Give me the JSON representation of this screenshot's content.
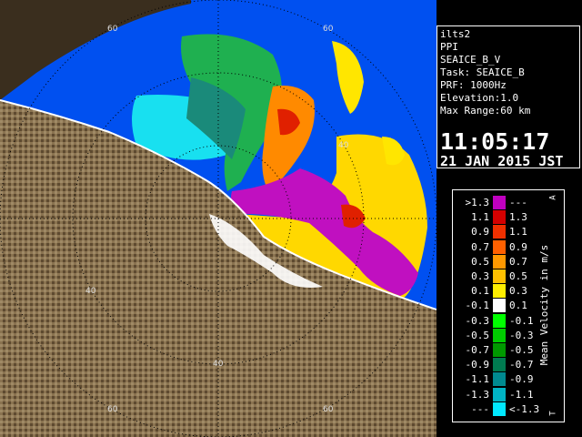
{
  "info": {
    "site": "ilts2",
    "mode": "PPI",
    "product": "SEAICE_B_V",
    "task": "Task: SEAICE_B",
    "prf": "PRF: 1000Hz",
    "elevation": "Elevation:1.0",
    "max_range": "Max Range:60 km",
    "time": "11:05:17",
    "date": "21 JAN 2015 JST"
  },
  "legend": {
    "unit": "Mean Velocity in m/s",
    "corner_top": "A",
    "corner_bottom": "T",
    "rows": [
      {
        "left": ">1.3",
        "right": "---",
        "color": "#c000c0"
      },
      {
        "left": "1.1",
        "right": "1.3",
        "color": "#d40000"
      },
      {
        "left": "0.9",
        "right": "1.1",
        "color": "#f03000"
      },
      {
        "left": "0.7",
        "right": "0.9",
        "color": "#ff6000"
      },
      {
        "left": "0.5",
        "right": "0.7",
        "color": "#ff9900"
      },
      {
        "left": "0.3",
        "right": "0.5",
        "color": "#ffc000"
      },
      {
        "left": "0.1",
        "right": "0.3",
        "color": "#ffee00"
      },
      {
        "left": "-0.1",
        "right": "0.1",
        "color": "#ffffff"
      },
      {
        "left": "-0.3",
        "right": "-0.1",
        "color": "#00ff00"
      },
      {
        "left": "-0.5",
        "right": "-0.3",
        "color": "#00cc00"
      },
      {
        "left": "-0.7",
        "right": "-0.5",
        "color": "#009900"
      },
      {
        "left": "-0.9",
        "right": "-0.7",
        "color": "#007a50"
      },
      {
        "left": "-1.1",
        "right": "-0.9",
        "color": "#008a90"
      },
      {
        "left": "-1.3",
        "right": "-1.1",
        "color": "#00b4c4"
      },
      {
        "left": "---",
        "right": "<-1.3",
        "color": "#00e8ff"
      }
    ]
  },
  "range_labels": {
    "top_left_60": "60",
    "top_center_60": "60",
    "right_40": "40",
    "left_40": "40",
    "bottom_40": "40",
    "bottom_60": "60",
    "bottom_right_60": "60"
  },
  "colors": {
    "sea_no_echo": "#0050f0",
    "land": "#8a7350",
    "coast": "#ffffff",
    "ring": "#000000"
  }
}
